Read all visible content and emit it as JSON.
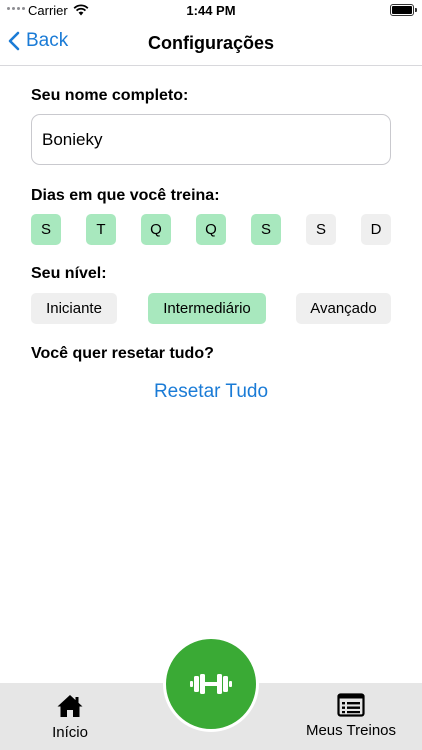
{
  "status_bar": {
    "carrier": "Carrier",
    "time": "1:44 PM"
  },
  "nav": {
    "back_label": "Back",
    "title": "Configurações"
  },
  "form": {
    "name_label": "Seu nome completo:",
    "name_value": "Bonieky",
    "days_label": "Dias em que você treina:",
    "days": [
      {
        "letter": "S",
        "selected": true
      },
      {
        "letter": "T",
        "selected": true
      },
      {
        "letter": "Q",
        "selected": true
      },
      {
        "letter": "Q",
        "selected": true
      },
      {
        "letter": "S",
        "selected": true
      },
      {
        "letter": "S",
        "selected": false
      },
      {
        "letter": "D",
        "selected": false
      }
    ],
    "level_label": "Seu nível:",
    "levels": [
      {
        "label": "Iniciante",
        "selected": false
      },
      {
        "label": "Intermediário",
        "selected": true
      },
      {
        "label": "Avançado",
        "selected": false
      }
    ],
    "reset_question": "Você quer resetar tudo?",
    "reset_button": "Resetar Tudo"
  },
  "tab_bar": {
    "home_label": "Início",
    "home_icon": "home-icon",
    "center_icon": "dumbbell-icon",
    "workouts_label": "Meus Treinos",
    "workouts_icon": "list-icon"
  },
  "colors": {
    "accent": "#1a7bd6",
    "selected_chip": "#a8e8be",
    "unselected_chip": "#efefef",
    "fab_green": "#3aaa35",
    "tab_bar_bg": "#e6e6e6"
  }
}
